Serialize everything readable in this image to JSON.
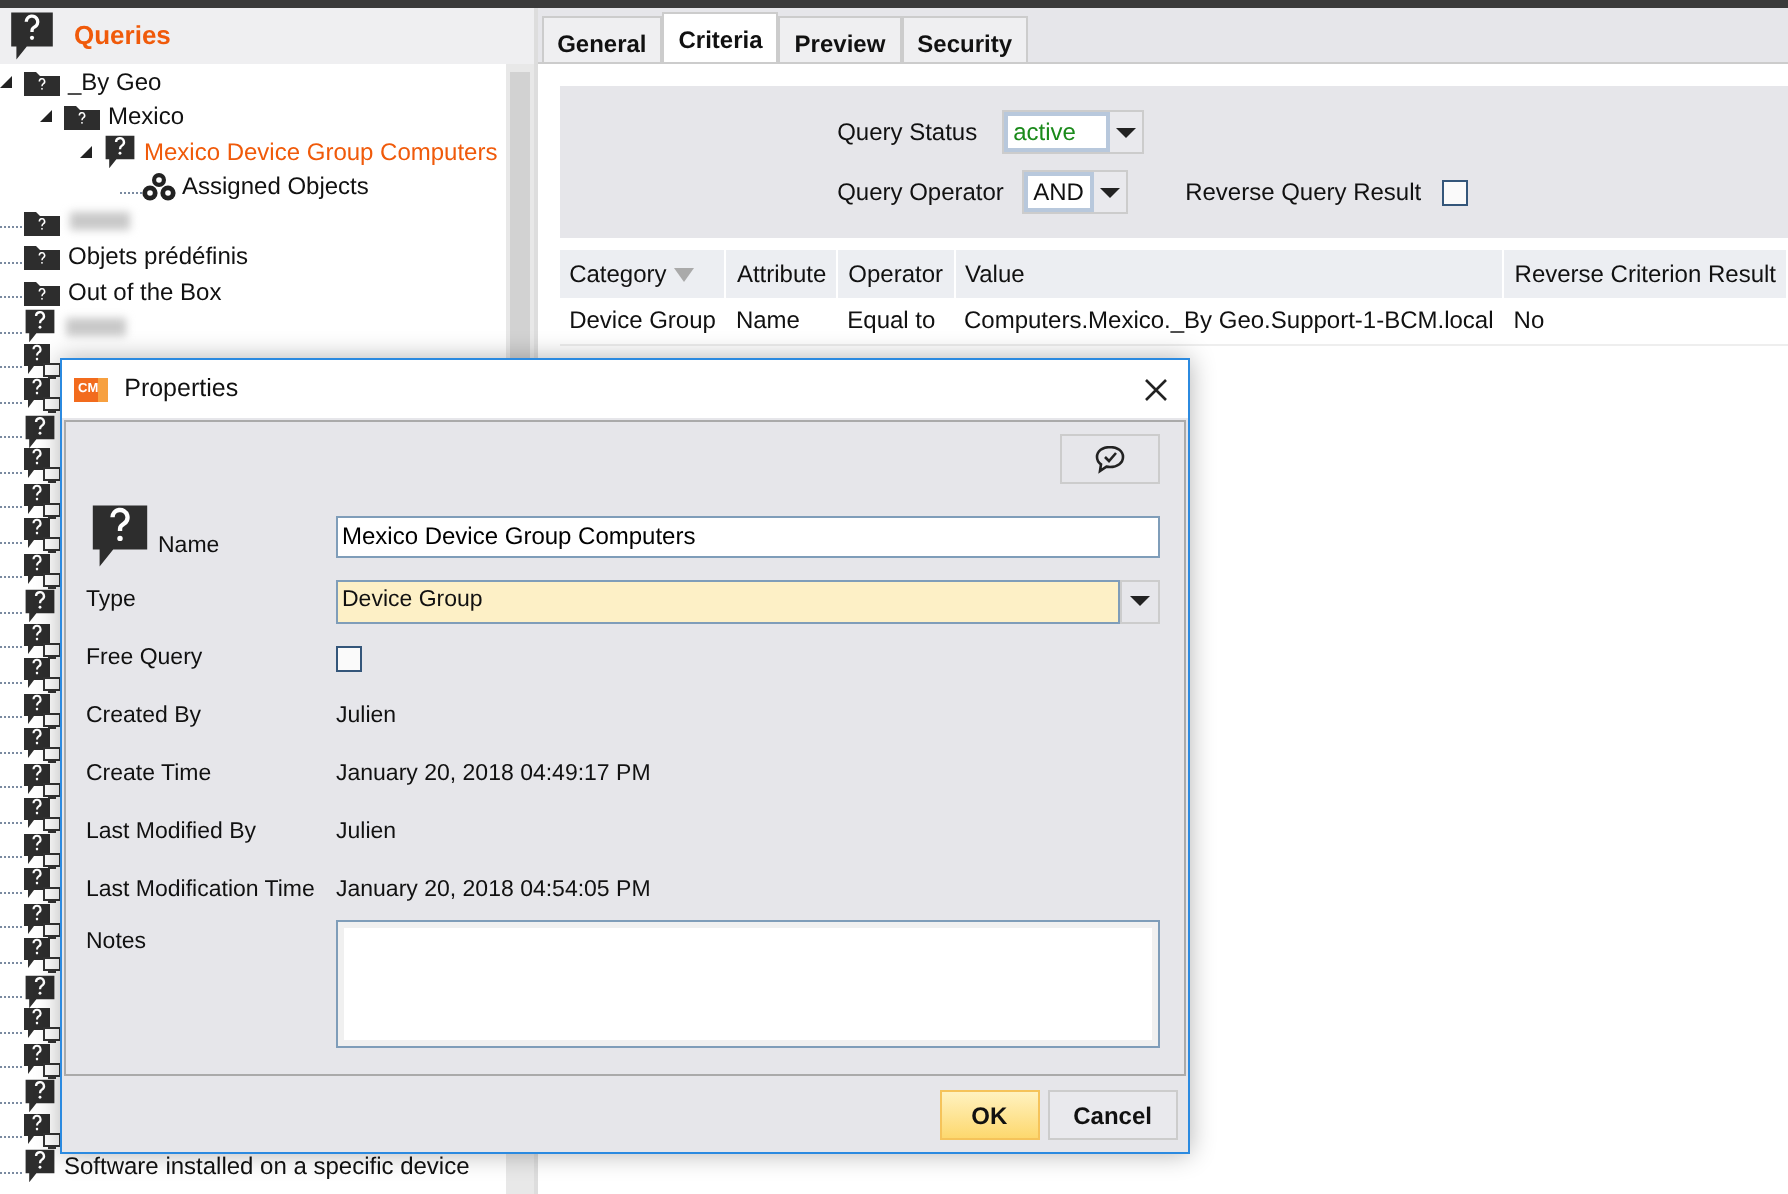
{
  "left_pane": {
    "title": "Queries",
    "tree": [
      {
        "kind": "folder",
        "label": "_By Geo",
        "selected": false,
        "expanded": true,
        "children": [
          {
            "kind": "folder",
            "label": "Mexico",
            "selected": false,
            "expanded": true,
            "children": [
              {
                "kind": "query",
                "label": "Mexico Device Group Computers",
                "selected": true,
                "expanded": true,
                "children": [
                  {
                    "kind": "objects",
                    "label": "Assigned Objects",
                    "selected": false
                  }
                ]
              }
            ]
          }
        ]
      },
      {
        "kind": "folder",
        "blurred": true,
        "selected": false
      },
      {
        "kind": "folder",
        "label": "Objets prédéfinis",
        "selected": false
      },
      {
        "kind": "folder",
        "label": "Out of the Box",
        "selected": false
      },
      {
        "kind": "query",
        "blurred": true,
        "selected": false
      },
      {
        "kind": "device-query",
        "selected": false
      },
      {
        "kind": "device-query",
        "selected": false
      },
      {
        "kind": "query",
        "selected": false
      },
      {
        "kind": "device-query",
        "selected": false
      },
      {
        "kind": "device-query",
        "selected": false
      },
      {
        "kind": "device-query",
        "selected": false
      },
      {
        "kind": "device-query",
        "selected": false
      },
      {
        "kind": "query",
        "selected": false
      },
      {
        "kind": "device-query",
        "selected": false
      },
      {
        "kind": "device-query",
        "selected": false
      },
      {
        "kind": "device-query",
        "selected": false
      },
      {
        "kind": "device-query",
        "selected": false
      },
      {
        "kind": "device-query",
        "selected": false
      },
      {
        "kind": "device-query",
        "selected": false
      },
      {
        "kind": "device-query",
        "selected": false
      },
      {
        "kind": "device-query",
        "selected": false
      },
      {
        "kind": "device-query",
        "selected": false
      },
      {
        "kind": "device-query",
        "selected": false
      },
      {
        "kind": "query",
        "selected": false
      },
      {
        "kind": "device-query",
        "selected": false
      },
      {
        "kind": "device-query",
        "selected": false
      },
      {
        "kind": "query",
        "selected": false
      },
      {
        "kind": "device-query",
        "selected": false
      },
      {
        "kind": "query",
        "label": "Software installed on a specific device",
        "selected": false
      }
    ]
  },
  "tabs": [
    {
      "label": "General",
      "selected": false
    },
    {
      "label": "Criteria",
      "selected": true
    },
    {
      "label": "Preview",
      "selected": false
    },
    {
      "label": "Security",
      "selected": false
    }
  ],
  "criteria": {
    "query_status": {
      "label": "Query Status",
      "value": "active"
    },
    "query_operator": {
      "label": "Query Operator",
      "value": "AND"
    },
    "reverse_query_result": {
      "label": "Reverse Query Result",
      "checked": false
    }
  },
  "table": {
    "columns": [
      {
        "label": "Category",
        "sorted": true
      },
      {
        "label": "Attribute",
        "sorted": false
      },
      {
        "label": "Operator",
        "sorted": false
      },
      {
        "label": "Value",
        "sorted": false
      },
      {
        "label": "Reverse Criterion Result",
        "sorted": false
      }
    ],
    "rows": [
      [
        "Device Group",
        "Name",
        "Equal to",
        "Computers.Mexico._By Geo.Support-1-BCM.local",
        "No"
      ]
    ]
  },
  "dialog": {
    "logo": "CM",
    "title": "Properties",
    "name": {
      "label": "Name",
      "value": "Mexico Device Group Computers"
    },
    "type": {
      "label": "Type",
      "value": "Device Group"
    },
    "free_query": {
      "label": "Free Query",
      "checked": false
    },
    "fields": [
      {
        "label": "Created By",
        "value": "Julien"
      },
      {
        "label": "Create Time",
        "value": "January 20, 2018 04:49:17 PM"
      },
      {
        "label": "Last Modified By",
        "value": "Julien"
      },
      {
        "label": "Last Modification Time",
        "value": "January 20, 2018 04:54:05 PM"
      }
    ],
    "notes": {
      "label": "Notes"
    },
    "buttons": [
      {
        "label": "OK",
        "primary": true
      },
      {
        "label": "Cancel",
        "primary": false
      }
    ]
  }
}
